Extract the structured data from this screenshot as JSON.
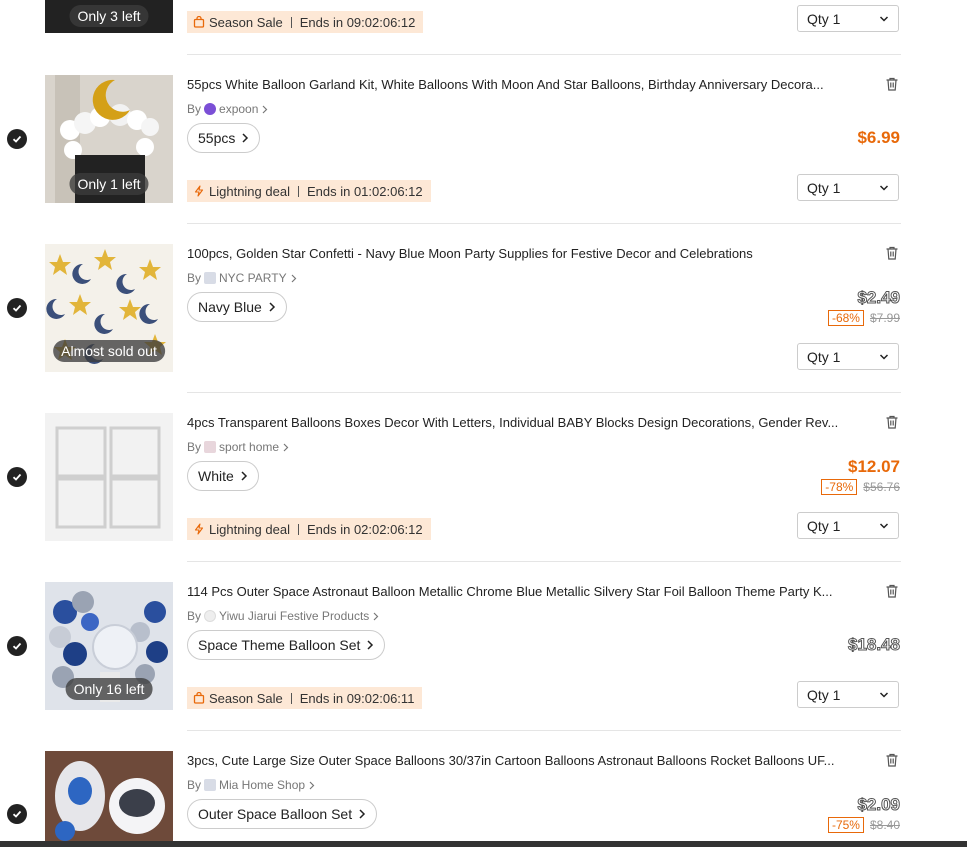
{
  "colors": {
    "accent": "#e8690a",
    "promo_bg": "#fde8d6",
    "check": "#222222"
  },
  "items": [
    {
      "stock_badge": "Only 3 left",
      "promo": {
        "icon": "bag-icon",
        "label": "Season Sale",
        "ends": "Ends in 09:02:06:12"
      },
      "qty_label": "Qty",
      "qty_value": "1"
    },
    {
      "title": "55pcs White Balloon Garland Kit, White Balloons With Moon And Star Balloons, Birthday Anniversary Decora...",
      "by": "By",
      "seller": "expoon",
      "variant": "55pcs",
      "price": "$6.99",
      "stock_badge": "Only 1 left",
      "promo": {
        "icon": "lightning-icon",
        "label": "Lightning deal",
        "ends": "Ends in 01:02:06:12"
      },
      "qty_label": "Qty",
      "qty_value": "1"
    },
    {
      "title": "100pcs, Golden Star Confetti - Navy Blue Moon Party Supplies for Festive Decor and Celebrations",
      "by": "By",
      "seller": "NYC PARTY",
      "variant": "Navy Blue",
      "price": "$2.49",
      "discount": "-68%",
      "original_price": "$7.99",
      "stock_badge": "Almost sold out",
      "qty_label": "Qty",
      "qty_value": "1"
    },
    {
      "title": "4pcs Transparent Balloons Boxes Decor With Letters, Individual BABY Blocks Design Decorations, Gender Rev...",
      "by": "By",
      "seller": "sport home",
      "variant": "White",
      "price": "$12.07",
      "discount": "-78%",
      "original_price": "$56.76",
      "promo": {
        "icon": "lightning-icon",
        "label": "Lightning deal",
        "ends": "Ends in 02:02:06:12"
      },
      "qty_label": "Qty",
      "qty_value": "1"
    },
    {
      "title": "114 Pcs Outer Space Astronaut Balloon Metallic Chrome Blue Metallic Silvery Star Foil Balloon Theme Party K...",
      "by": "By",
      "seller": "Yiwu Jiarui Festive Products",
      "variant": "Space Theme Balloon Set",
      "price": "$18.48",
      "stock_badge": "Only 16 left",
      "promo": {
        "icon": "bag-icon",
        "label": "Season Sale",
        "ends": "Ends in 09:02:06:11"
      },
      "qty_label": "Qty",
      "qty_value": "1"
    },
    {
      "title": "3pcs, Cute Large Size Outer Space Balloons 30/37in Cartoon Balloons Astronaut Balloons Rocket Balloons UF...",
      "by": "By",
      "seller": "Mia Home Shop",
      "variant": "Outer Space Balloon Set",
      "price": "$2.09",
      "discount": "-75%",
      "original_price": "$8.40"
    }
  ]
}
